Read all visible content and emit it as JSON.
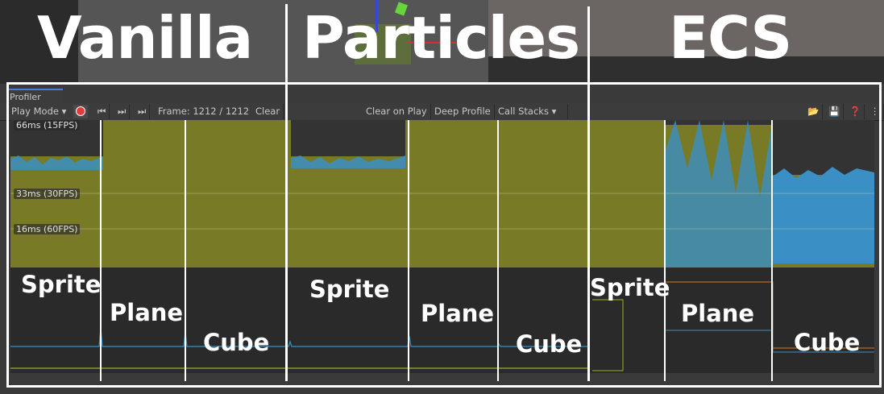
{
  "headings": [
    "Vanilla",
    "Particles",
    "ECS"
  ],
  "window": {
    "tab": "Profiler"
  },
  "toolbar": {
    "play_mode": "Play Mode",
    "frame": "Frame: 1212 / 1212",
    "clear": "Clear",
    "clear_on_play": "Clear on Play",
    "deep_profile": "Deep Profile",
    "call_stacks": "Call Stacks"
  },
  "chart": {
    "label_66": "66ms (15FPS)",
    "label_33": "33ms (30FPS)",
    "label_16": "16ms (60FPS)",
    "fill_color": "#787a25",
    "series_colors": [
      "#9ab521",
      "#3a8fc4"
    ]
  },
  "segments": {
    "vanilla": [
      "Sprite",
      "Plane",
      "Cube"
    ],
    "particles": [
      "Sprite",
      "Plane",
      "Cube"
    ],
    "ecs": [
      "Sprite",
      "Plane",
      "Cube"
    ]
  }
}
